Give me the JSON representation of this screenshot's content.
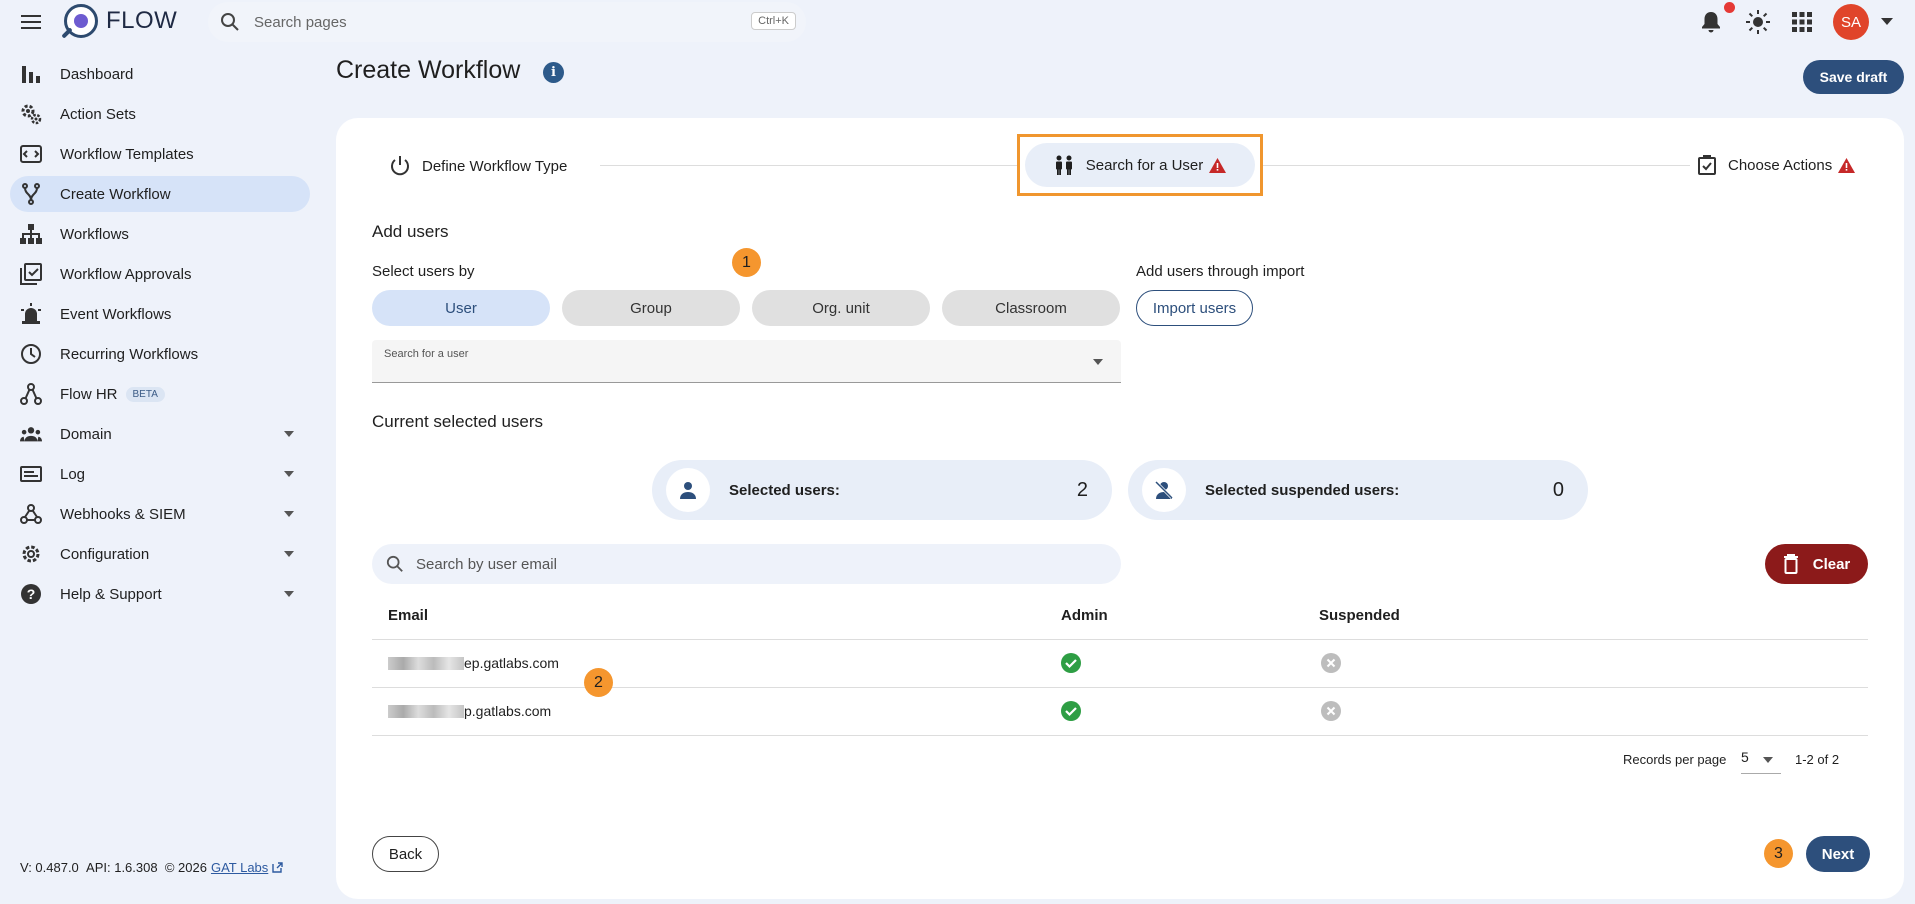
{
  "app": {
    "name": "FLOW"
  },
  "search": {
    "placeholder": "Search pages",
    "shortcut": "Ctrl+K"
  },
  "user": {
    "initials": "SA",
    "avatar_color": "#e0442a"
  },
  "sidebar": {
    "items": [
      {
        "label": "Dashboard",
        "icon": "bar-chart-icon"
      },
      {
        "label": "Action Sets",
        "icon": "gears-icon"
      },
      {
        "label": "Workflow Templates",
        "icon": "template-icon"
      },
      {
        "label": "Create Workflow",
        "icon": "fork-icon",
        "active": true
      },
      {
        "label": "Workflows",
        "icon": "hierarchy-icon"
      },
      {
        "label": "Workflow Approvals",
        "icon": "approval-icon"
      },
      {
        "label": "Event Workflows",
        "icon": "alarm-icon"
      },
      {
        "label": "Recurring Workflows",
        "icon": "clock-icon"
      },
      {
        "label": "Flow HR",
        "icon": "flow-hr-icon",
        "badge": "BETA"
      },
      {
        "label": "Domain",
        "icon": "people-icon",
        "expandable": true
      },
      {
        "label": "Log",
        "icon": "log-icon",
        "expandable": true
      },
      {
        "label": "Webhooks & SIEM",
        "icon": "webhook-icon",
        "expandable": true
      },
      {
        "label": "Configuration",
        "icon": "gear-icon",
        "expandable": true
      },
      {
        "label": "Help & Support",
        "icon": "help-icon",
        "expandable": true
      }
    ]
  },
  "footer": {
    "version": "V: 0.487.0",
    "api": "API: 1.6.308",
    "copyright": "© 2026",
    "link": "GAT Labs"
  },
  "header": {
    "title": "Create Workflow",
    "save_draft": "Save draft"
  },
  "stepper": {
    "step1": "Define Workflow Type",
    "step2": "Search for a User",
    "step3": "Choose Actions"
  },
  "add_users": {
    "heading": "Add users",
    "select_by": "Select users by",
    "import_label": "Add users through import",
    "options": [
      "User",
      "Group",
      "Org. unit",
      "Classroom"
    ],
    "import_button": "Import users",
    "search_label": "Search for a user"
  },
  "current": {
    "heading": "Current selected users",
    "selected_label": "Selected users:",
    "selected_value": "2",
    "suspended_label": "Selected suspended users:",
    "suspended_value": "0"
  },
  "email_search": {
    "placeholder": "Search by user email"
  },
  "clear_button": "Clear",
  "table": {
    "headers": {
      "email": "Email",
      "admin": "Admin",
      "suspended": "Suspended"
    },
    "rows": [
      {
        "email_suffix": "ep.gatlabs.com",
        "admin": true,
        "suspended": false
      },
      {
        "email_suffix": "p.gatlabs.com",
        "admin": true,
        "suspended": false
      }
    ]
  },
  "pagination": {
    "label": "Records per page",
    "per_page": "5",
    "range": "1-2 of 2"
  },
  "buttons": {
    "back": "Back",
    "next": "Next"
  },
  "annotations": [
    "1",
    "2",
    "3"
  ],
  "colors": {
    "primary": "#2d4f7c",
    "danger": "#8c1a1a",
    "highlight": "#f0962e",
    "badge": "#f5962e",
    "success": "#2e9e44"
  }
}
